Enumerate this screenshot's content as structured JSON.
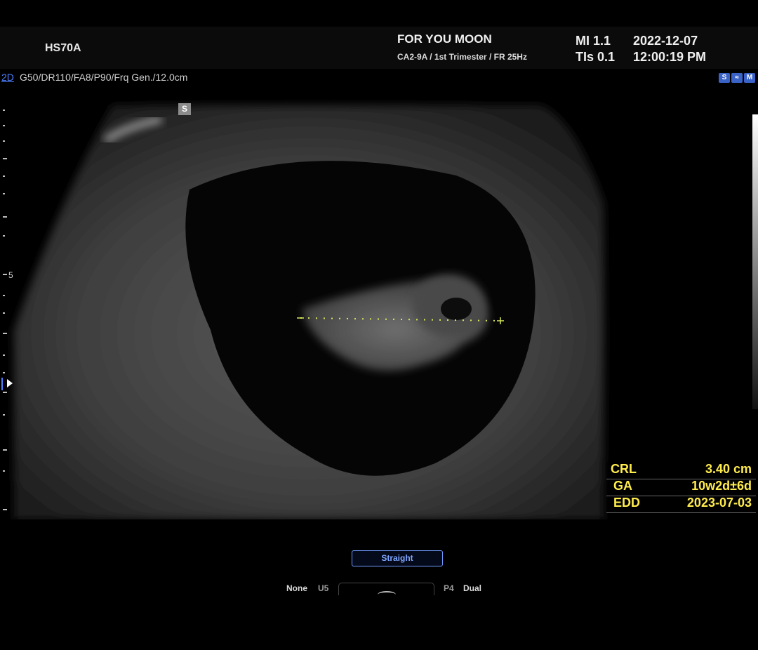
{
  "header": {
    "model": "HS70A",
    "patient": "FOR YOU MOON",
    "preset": "CA2-9A / 1st Trimester / FR 25Hz",
    "mi": "MI  1.1",
    "tis": "TIs 0.1",
    "date": "2022-12-07",
    "time": "12:00:19 PM"
  },
  "imaging": {
    "mode": "2D",
    "params": "G50/DR110/FA8/P90/Frq Gen./12.0cm",
    "depth_label": "5",
    "orientation_marker": "S"
  },
  "status_icons": [
    "S",
    "",
    "M"
  ],
  "measurements": [
    {
      "key": "CRL",
      "value": "3.40 cm"
    },
    {
      "key": "GA",
      "value": "10w2d±6d"
    },
    {
      "key": "EDD",
      "value": "2023-07-03"
    }
  ],
  "controls": {
    "straight_label": "Straight",
    "none_label": "None",
    "u5_label": "U5",
    "p4_label": "P4",
    "dual_label": "Dual"
  },
  "colors": {
    "measurement_text": "#ffec4d",
    "mode_accent": "#4d7fff",
    "caliper": "#d8e85a"
  }
}
